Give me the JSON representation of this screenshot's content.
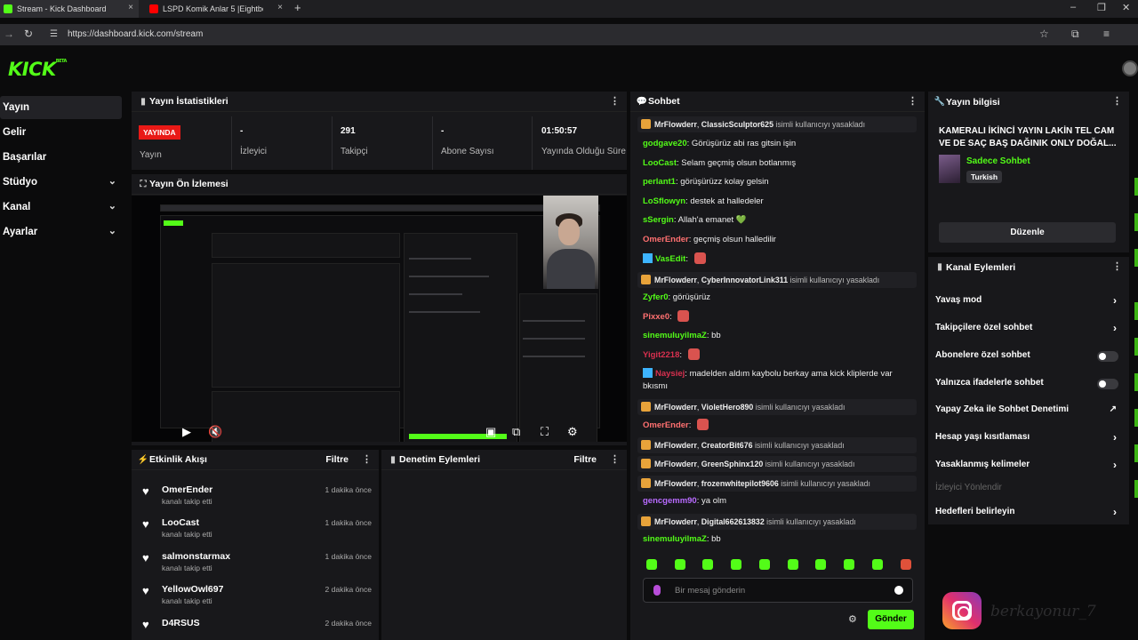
{
  "browser": {
    "tabs": [
      {
        "title": "Stream - Kick Dashboard",
        "close": "×"
      },
      {
        "title": "LSPD Komik Anlar 5 |Eightborn",
        "close": "×"
      }
    ],
    "new_tab": "+",
    "url": "https://dashboard.kick.com/stream"
  },
  "logo": "KICK",
  "sidebar": {
    "items": [
      {
        "label": "Yayın"
      },
      {
        "label": "Gelir"
      },
      {
        "label": "Başarılar"
      },
      {
        "label": "Stüdyo"
      },
      {
        "label": "Kanal"
      },
      {
        "label": "Ayarlar"
      }
    ]
  },
  "stats": {
    "title": "Yayın İstatistikleri",
    "live_badge": "YAYINDA",
    "live_label": "Yayın",
    "viewers_value": "-",
    "viewers_label": "İzleyici",
    "followers_value": "291",
    "followers_label": "Takipçi",
    "subs_value": "-",
    "subs_label": "Abone Sayısı",
    "uptime_value": "01:50:57",
    "uptime_label": "Yayında Olduğu Süre"
  },
  "preview": {
    "title": "Yayın Ön İzlemesi"
  },
  "activity": {
    "title": "Etkinlik Akışı",
    "filter": "Filtre",
    "events": [
      {
        "name": "OmerEnder",
        "action": "kanalı takip etti",
        "time": "1 dakika önce"
      },
      {
        "name": "LooCast",
        "action": "kanalı takip etti",
        "time": "1 dakika önce"
      },
      {
        "name": "salmonstarmax",
        "action": "kanalı takip etti",
        "time": "1 dakika önce"
      },
      {
        "name": "YellowOwl697",
        "action": "kanalı takip etti",
        "time": "2 dakika önce"
      },
      {
        "name": "D4RSUS",
        "action": "",
        "time": "2 dakika önce"
      }
    ]
  },
  "moderation": {
    "title": "Denetim Eylemleri",
    "filter": "Filtre"
  },
  "chat": {
    "title": "Sohbet",
    "messages": [
      {
        "type": "ban",
        "mod": "MrFlowderr",
        "user": "ClassicSculptor625",
        "text": "isimli kullanıcıyı yasakladı"
      },
      {
        "type": "msg",
        "user": "godgave20",
        "color": "#53fc18",
        "text": "Görüşürüz abi ras gitsin işin"
      },
      {
        "type": "msg",
        "user": "LooCast",
        "color": "#53fc18",
        "text": "Selam geçmiş olsun botlanmış"
      },
      {
        "type": "msg",
        "user": "perlant1",
        "color": "#53fc18",
        "text": "görüşürüzz kolay gelsin"
      },
      {
        "type": "msg",
        "user": "LoSflowyn",
        "color": "#53fc18",
        "text": "destek at halledeler"
      },
      {
        "type": "msg",
        "user": "sSergin",
        "color": "#53fc18",
        "text": "Allah'a emanet 💚"
      },
      {
        "type": "msg",
        "user": "OmerEnder",
        "color": "#ff7070",
        "text": "geçmiş olsun halledilir"
      },
      {
        "type": "msg",
        "user": "VasEdit",
        "color": "#53fc18",
        "text": ""
      },
      {
        "type": "ban",
        "mod": "MrFlowderr",
        "user": "CyberInnovatorLink311",
        "text": "isimli kullanıcıyı yasakladı"
      },
      {
        "type": "msg",
        "user": "Zyfer0",
        "color": "#53fc18",
        "text": "görüşürüz"
      },
      {
        "type": "msg",
        "user": "Pixxe0",
        "color": "#ff7070",
        "text": ""
      },
      {
        "type": "msg",
        "user": "sinemuluyilmaZ",
        "color": "#53fc18",
        "text": "bb"
      },
      {
        "type": "msg",
        "user": "Yigit2218",
        "color": "#d9304f",
        "text": ""
      },
      {
        "type": "msg",
        "user": "Naysiej",
        "color": "#d9304f",
        "text": "madelden aldım kaybolu berkay ama kick kliplerde var bkısmı"
      },
      {
        "type": "ban",
        "mod": "MrFlowderr",
        "user": "VioletHero890",
        "text": "isimli kullanıcıyı yasakladı"
      },
      {
        "type": "msg",
        "user": "OmerEnder",
        "color": "#ff7070",
        "text": ""
      },
      {
        "type": "ban",
        "mod": "MrFlowderr",
        "user": "CreatorBit676",
        "text": "isimli kullanıcıyı yasakladı"
      },
      {
        "type": "ban",
        "mod": "MrFlowderr",
        "user": "GreenSphinx120",
        "text": "isimli kullanıcıyı yasakladı"
      },
      {
        "type": "ban",
        "mod": "MrFlowderr",
        "user": "frozenwhitepilot9606",
        "text": "isimli kullanıcıyı yasakladı"
      },
      {
        "type": "msg",
        "user": "gencgemm90",
        "color": "#b86bff",
        "text": "ya olm"
      },
      {
        "type": "ban",
        "mod": "MrFlowderr",
        "user": "Digital662613832",
        "text": "isimli kullanıcıyı yasakladı"
      },
      {
        "type": "msg",
        "user": "sinemuluyilmaZ",
        "color": "#53fc18",
        "text": "bb"
      }
    ],
    "input_placeholder": "Bir mesaj gönderin",
    "send_label": "Gönder"
  },
  "stream_info": {
    "title": "Yayın bilgisi",
    "stream_title": "KAMERALI İKİNCİ YAYIN LAKİN TEL CAM VE DE SAÇ BAŞ DAĞINIK ONLY DOĞAL...",
    "category": "Sadece Sohbet",
    "language": "Turkish",
    "edit_label": "Düzenle"
  },
  "channel_actions": {
    "title": "Kanal Eylemleri",
    "items": [
      {
        "label": "Yavaş mod",
        "control": "arrow"
      },
      {
        "label": "Takipçilere özel sohbet",
        "control": "arrow"
      },
      {
        "label": "Abonelere özel sohbet",
        "control": "toggle"
      },
      {
        "label": "Yalnızca ifadelerle sohbet",
        "control": "toggle"
      },
      {
        "label": "Yapay Zeka ile Sohbet Denetimi",
        "control": "external"
      },
      {
        "label": "Hesap yaşı kısıtlaması",
        "control": "arrow"
      },
      {
        "label": "Yasaklanmış kelimeler",
        "control": "arrow"
      },
      {
        "label": "İzleyici Yönlendir",
        "control": "none"
      },
      {
        "label": "Hedefleri belirleyin",
        "control": "arrow"
      }
    ]
  },
  "overlay": {
    "handle": "berkayonur_7"
  }
}
